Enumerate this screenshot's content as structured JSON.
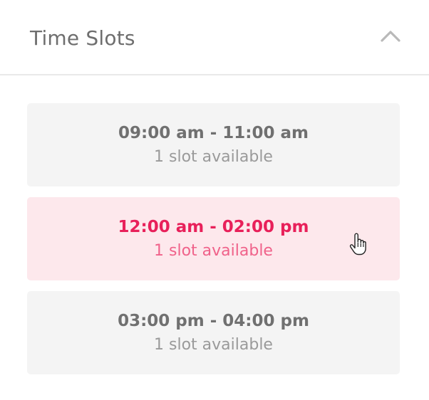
{
  "header": {
    "title": "Time Slots",
    "toggle_icon": "chevron-up-icon"
  },
  "slots": [
    {
      "time": "09:00 am - 11:00 am",
      "availability": "1 slot available",
      "selected": false
    },
    {
      "time": "12:00 am - 02:00 pm",
      "availability": "1 slot available",
      "selected": true
    },
    {
      "time": "03:00 pm - 04:00 pm",
      "availability": "1 slot available",
      "selected": false
    }
  ],
  "colors": {
    "accent": "#e8205a",
    "selected_bg": "#fde8ec",
    "slot_bg": "#f4f4f4",
    "text_gray": "#707070"
  },
  "cursor_icon": "hand-pointer-icon"
}
